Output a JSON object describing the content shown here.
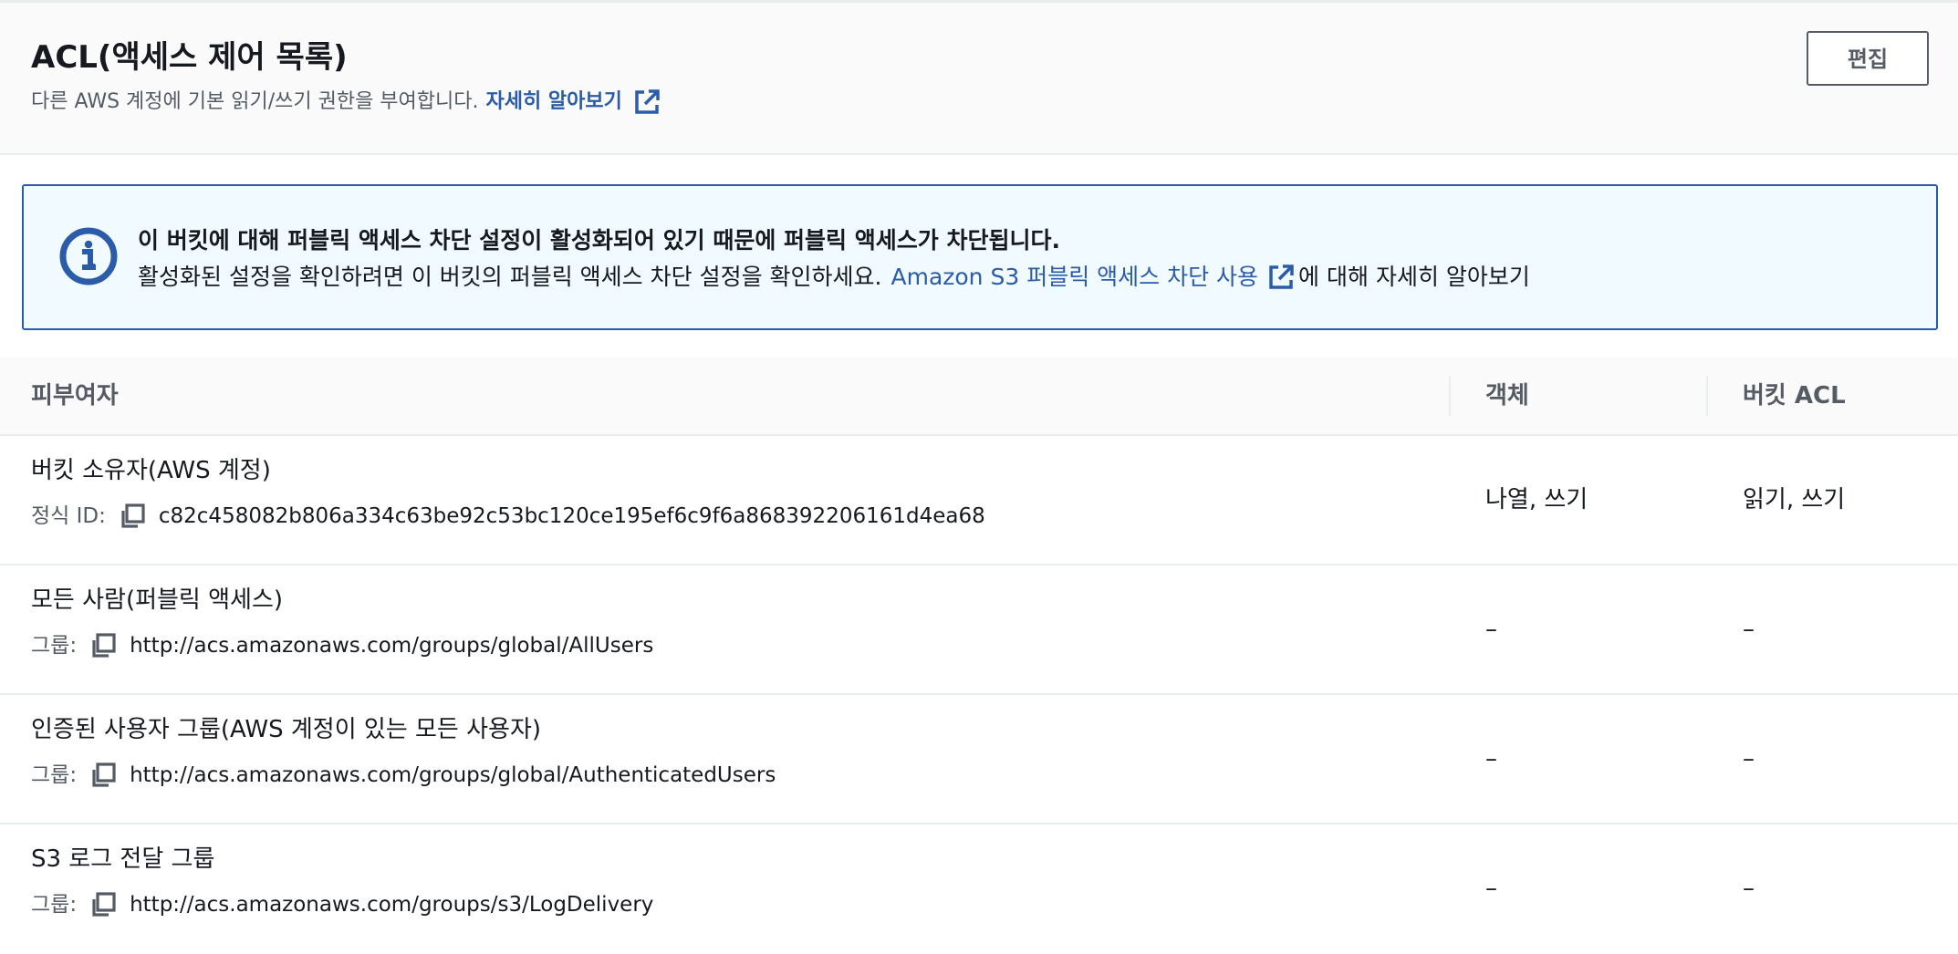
{
  "header": {
    "title": "ACL(액세스 제어 목록)",
    "description": "다른 AWS 계정에 기본 읽기/쓰기 권한을 부여합니다.",
    "learn_more": "자세히 알아보기",
    "edit_label": "편집"
  },
  "alert": {
    "title": "이 버킷에 대해 퍼블릭 액세스 차단 설정이 활성화되어 있기 때문에 퍼블릭 액세스가 차단됩니다.",
    "body": "활성화된 설정을 확인하려면 이 버킷의 퍼블릭 액세스 차단 설정을 확인하세요.",
    "link": "Amazon S3 퍼블릭 액세스 차단 사용",
    "suffix": "에 대해 자세히 알아보기"
  },
  "table": {
    "columns": [
      "피부여자",
      "객체",
      "버킷 ACL"
    ],
    "rows": [
      {
        "grantee": "버킷 소유자(AWS 계정)",
        "sub_label": "정식 ID:",
        "sub_value": "c82c458082b806a334c63be92c53bc120ce195ef6c9f6a868392206161d4ea68",
        "object": "나열, 쓰기",
        "bucket_acl": "읽기, 쓰기"
      },
      {
        "grantee": "모든 사람(퍼블릭 액세스)",
        "sub_label": "그룹:",
        "sub_value": "http://acs.amazonaws.com/groups/global/AllUsers",
        "object": "–",
        "bucket_acl": "–"
      },
      {
        "grantee": "인증된 사용자 그룹(AWS 계정이 있는 모든 사용자)",
        "sub_label": "그룹:",
        "sub_value": "http://acs.amazonaws.com/groups/global/AuthenticatedUsers",
        "object": "–",
        "bucket_acl": "–"
      },
      {
        "grantee": "S3 로그 전달 그룹",
        "sub_label": "그룹:",
        "sub_value": "http://acs.amazonaws.com/groups/s3/LogDelivery",
        "object": "–",
        "bucket_acl": "–"
      }
    ]
  },
  "icons": {
    "external_link": "external-link-icon",
    "info": "info-icon",
    "copy": "copy-icon"
  },
  "colors": {
    "link": "#2a5caa",
    "alert_background": "#f1faff",
    "alert_border": "#2a5caa",
    "header_background": "#fafafa",
    "text": "#16191f",
    "secondary_text": "#545b64"
  }
}
